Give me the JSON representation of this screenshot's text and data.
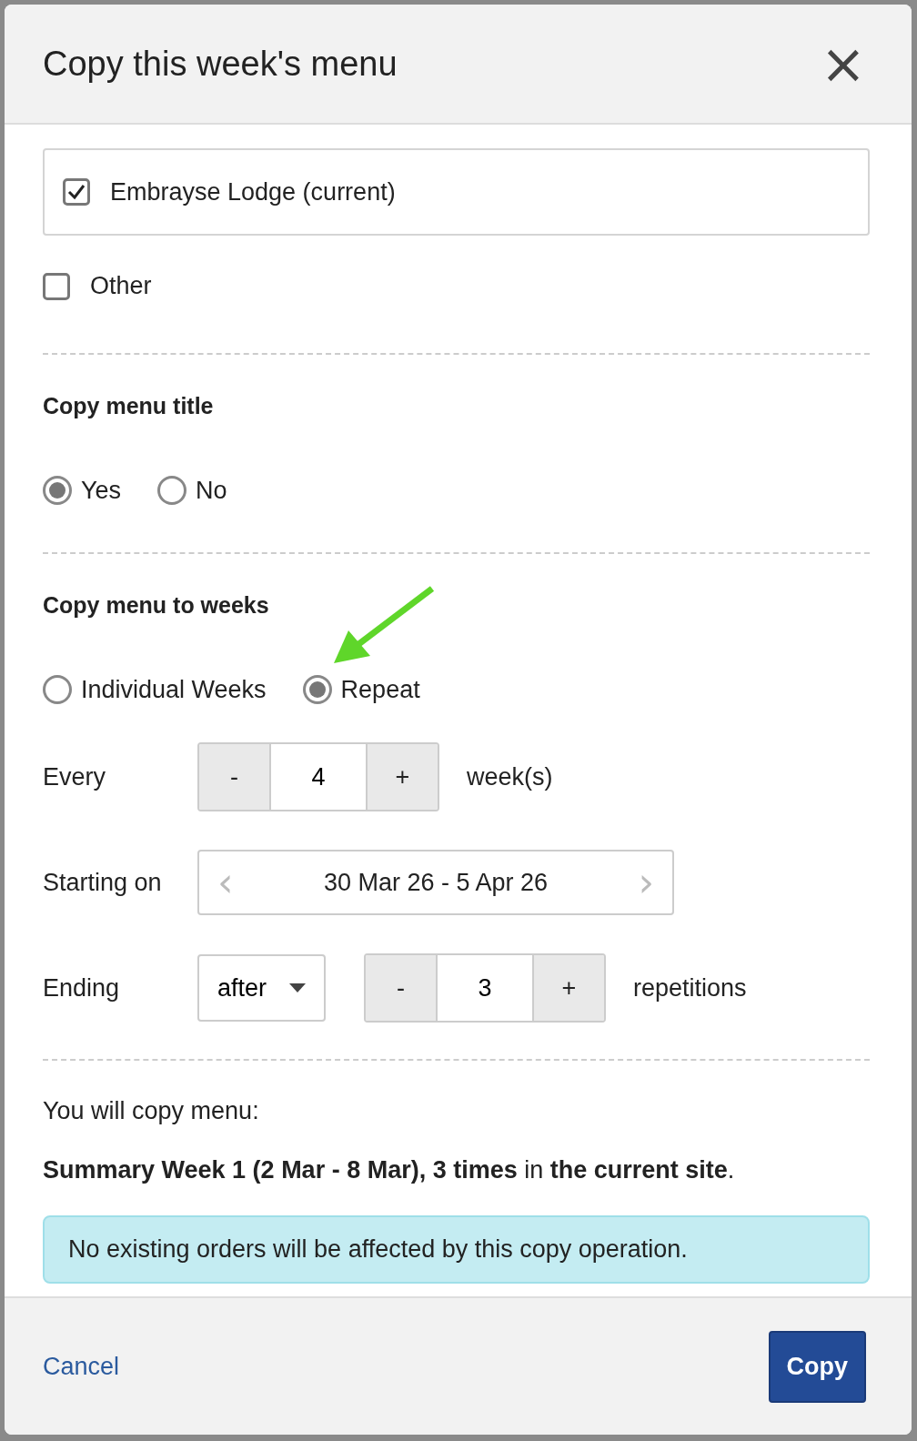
{
  "dialog": {
    "title": "Copy this week's menu",
    "close": "×"
  },
  "sites": [
    {
      "label": "Embrayse Lodge (current)",
      "checked": true,
      "boxed": true
    },
    {
      "label": "Other",
      "checked": false,
      "boxed": false
    }
  ],
  "title_section": {
    "heading": "Copy menu title",
    "options": [
      {
        "label": "Yes",
        "selected": true
      },
      {
        "label": "No",
        "selected": false
      }
    ]
  },
  "weeks_section": {
    "heading": "Copy menu to weeks",
    "options": [
      {
        "label": "Individual Weeks",
        "selected": false
      },
      {
        "label": "Repeat",
        "selected": true
      }
    ],
    "every": {
      "label": "Every",
      "minus": "-",
      "value": "4",
      "plus": "+",
      "unit": "week(s)"
    },
    "starting": {
      "label": "Starting on",
      "prev": "‹",
      "value": "30 Mar 26 - 5 Apr 26",
      "next": "›"
    },
    "ending": {
      "label": "Ending",
      "mode": "after",
      "minus": "-",
      "value": "3",
      "plus": "+",
      "unit": "repetitions"
    }
  },
  "summary": {
    "intro": "You will copy menu:",
    "text": "**Summary Week 1 (2 Mar - 8 Mar), 3 times** in **the current site**.",
    "notice": "No existing orders will be affected by this copy operation."
  },
  "footer": {
    "cancel": "Cancel",
    "copy": "Copy"
  }
}
